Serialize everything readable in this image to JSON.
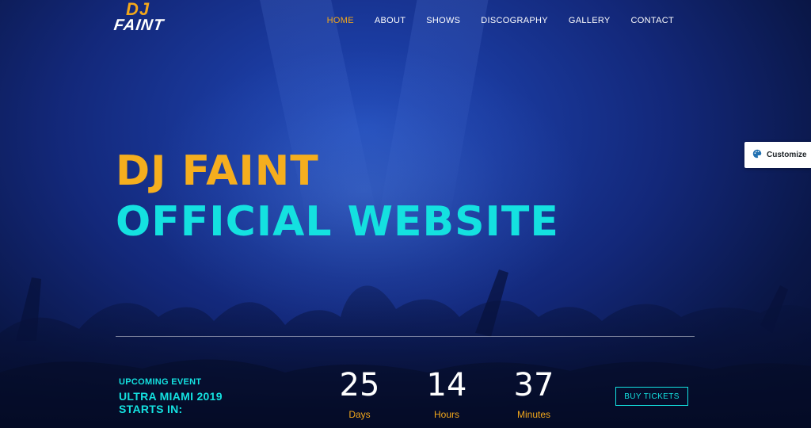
{
  "logo": {
    "top": "DJ",
    "bottom": "FAINT"
  },
  "nav": {
    "items": [
      {
        "label": "HOME",
        "active": true
      },
      {
        "label": "ABOUT",
        "active": false
      },
      {
        "label": "SHOWS",
        "active": false
      },
      {
        "label": "DISCOGRAPHY",
        "active": false
      },
      {
        "label": "GALLERY",
        "active": false
      },
      {
        "label": "CONTACT",
        "active": false
      }
    ]
  },
  "customize": {
    "label": "Customize",
    "icon": "palette-icon"
  },
  "hero": {
    "line1": "DJ FAINT",
    "line2": "OFFICIAL WEBSITE"
  },
  "event": {
    "label": "UPCOMING EVENT",
    "name_line1": "ULTRA MIAMI 2019",
    "name_line2": "STARTS IN:",
    "countdown": [
      {
        "value": "25",
        "unit": "Days"
      },
      {
        "value": "14",
        "unit": "Hours"
      },
      {
        "value": "37",
        "unit": "Minutes"
      }
    ],
    "button_label": "BUY TICKETS"
  },
  "colors": {
    "accent_orange": "#f2a71b",
    "accent_cyan": "#14e1e0",
    "background": "#13287a"
  }
}
